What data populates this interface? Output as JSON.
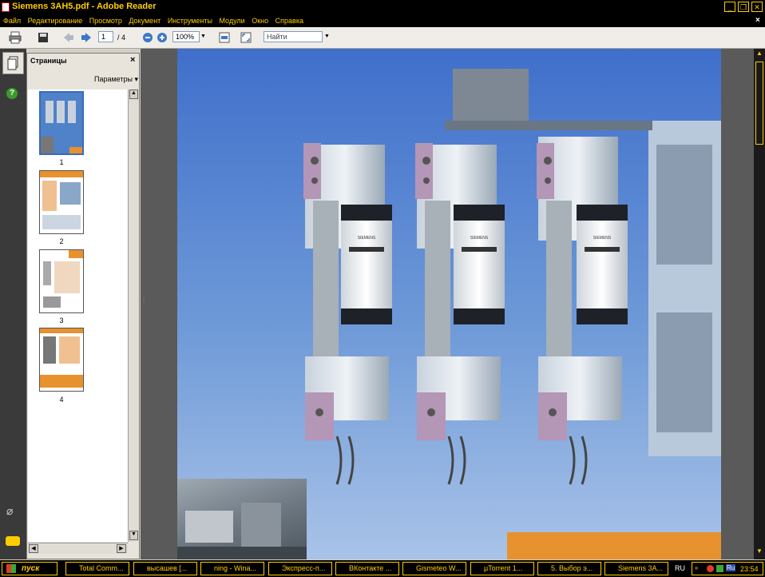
{
  "window": {
    "title": "Siemens 3AH5.pdf - Adobe Reader"
  },
  "menu": [
    "Файл",
    "Редактирование",
    "Просмотр",
    "Документ",
    "Инструменты",
    "Модули",
    "Окно",
    "Справка"
  ],
  "toolbar": {
    "page_current": "1",
    "page_total": "/ 4",
    "zoom": "100%",
    "search_placeholder": "Найти"
  },
  "panel": {
    "title": "Страницы",
    "options_label": "Параметры",
    "close": "×"
  },
  "thumbnails": [
    {
      "label": "1"
    },
    {
      "label": "2"
    },
    {
      "label": "3"
    },
    {
      "label": "4"
    }
  ],
  "document": {
    "brand_label": "SIEMENS"
  },
  "taskbar": {
    "start": "пуск",
    "tasks": [
      "Total Comm...",
      "высашев [...",
      "ning - Wina...",
      "Экспресс-п...",
      "ВКонтакте ...",
      "Gismeteo W...",
      "µTorrent 1...",
      "5. Выбор э...",
      "Siemens 3A..."
    ],
    "lang": "RU",
    "tray_lang": "Ru",
    "clock": "23:54"
  },
  "colors": {
    "accent": "#ffcc00",
    "chrome": "#000000",
    "page_blue": "#5a86cc",
    "orange": "#e8912f"
  }
}
